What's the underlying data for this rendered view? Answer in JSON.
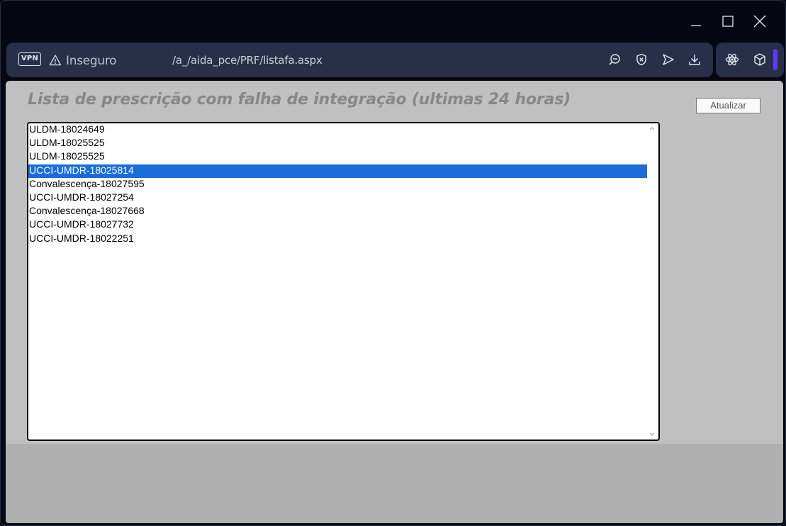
{
  "window": {
    "controls": {
      "minimize_icon": "minimize-icon",
      "maximize_icon": "maximize-icon",
      "close_icon": "close-icon"
    }
  },
  "address_bar": {
    "vpn_label": "VPN",
    "security_label": "Inseguro",
    "url": "/a_/aida_pce/PRF/listafa.aspx",
    "icons": [
      "zoom-out-icon",
      "shield-x-icon",
      "send-icon",
      "download-icon"
    ]
  },
  "extensions": {
    "icons": [
      "react-icon",
      "cube-icon"
    ],
    "accent_color": "#5b3cf5"
  },
  "page": {
    "title": "Lista de prescrição com falha de integração (ultimas 24 horas)",
    "refresh_button": "Atualizar",
    "list": {
      "items": [
        "ULDM-18024649",
        "ULDM-18025525",
        "ULDM-18025525",
        "UCCI-UMDR-18025814",
        "Convalescença-18027595",
        "UCCI-UMDR-18027254",
        "Convalescença-18027668",
        "UCCI-UMDR-18027732",
        "UCCI-UMDR-18022251"
      ],
      "selected_item": "UCCI-UMDR-18025814"
    }
  },
  "colors": {
    "chrome_bg": "#050812",
    "addr_bg": "#283049",
    "page_bg": "#c0c0c0",
    "selection": "#1a6cd8"
  }
}
